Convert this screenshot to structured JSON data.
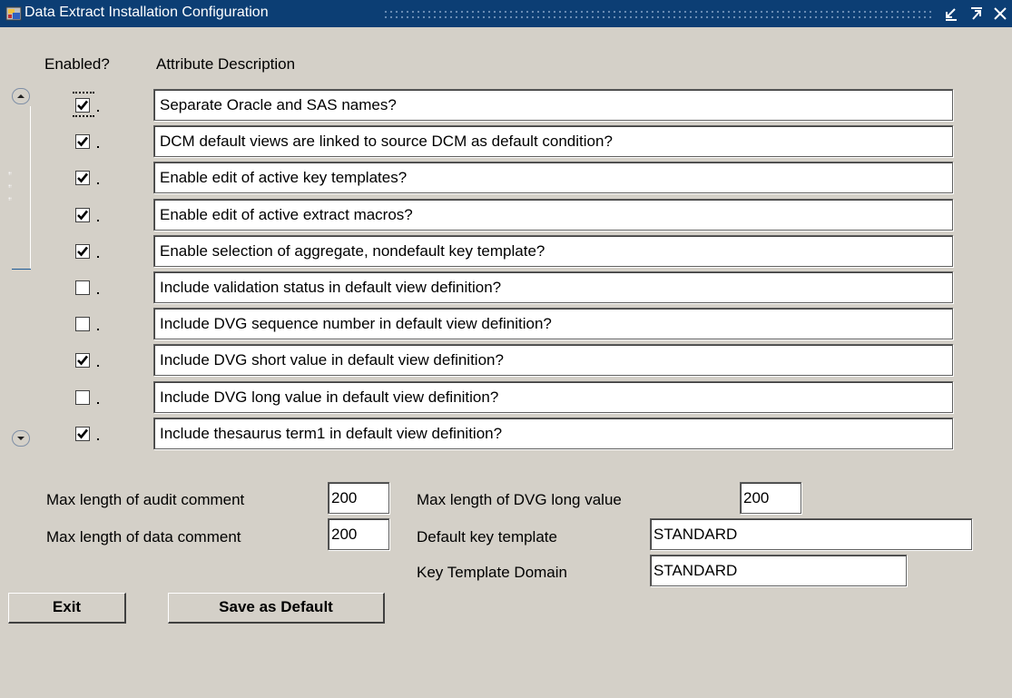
{
  "window": {
    "title": "Data Extract Installation Configuration",
    "title_bar_color": "#0c3e74",
    "background_color": "#d4d0c8"
  },
  "columns": {
    "enabled_label": "Enabled?",
    "description_label": "Attribute Description"
  },
  "rows": [
    {
      "enabled": true,
      "suffix": ".",
      "description": "Separate Oracle and SAS names?"
    },
    {
      "enabled": true,
      "suffix": ".",
      "description": "DCM default views are linked to source DCM as default condition?"
    },
    {
      "enabled": true,
      "suffix": ".",
      "description": "Enable edit of active key templates?"
    },
    {
      "enabled": true,
      "suffix": ".",
      "description": "Enable edit of active extract macros?"
    },
    {
      "enabled": true,
      "suffix": ".",
      "description": "Enable selection of aggregate, nondefault key template?"
    },
    {
      "enabled": false,
      "suffix": ".",
      "description": "Include validation status in default view definition?"
    },
    {
      "enabled": false,
      "suffix": ".",
      "description": "Include DVG sequence number in default view definition?"
    },
    {
      "enabled": true,
      "suffix": ".",
      "description": "Include DVG short value in default view definition?"
    },
    {
      "enabled": false,
      "suffix": ".",
      "description": "Include DVG long value in default view definition?"
    },
    {
      "enabled": true,
      "suffix": ".",
      "description": "Include thesaurus term1 in default view definition?"
    }
  ],
  "settings": {
    "audit_comment_label": "Max length of audit comment",
    "audit_comment_value": "200",
    "data_comment_label": "Max length of data comment",
    "data_comment_value": "200",
    "dvg_long_label": "Max length of DVG long value",
    "dvg_long_value": "200",
    "key_template_label": "Default key template",
    "key_template_value": "STANDARD",
    "key_domain_label": "Key Template Domain",
    "key_domain_value": "STANDARD"
  },
  "buttons": {
    "exit": "Exit",
    "save_default": "Save as Default"
  },
  "icons": {
    "app": "oracle-forms-icon",
    "minimize": "minimize-icon",
    "maximize": "maximize-icon",
    "close": "close-icon",
    "scroll_up": "scroll-up-icon",
    "scroll_down": "scroll-down-icon",
    "checkbox": "checkbox-icon"
  }
}
